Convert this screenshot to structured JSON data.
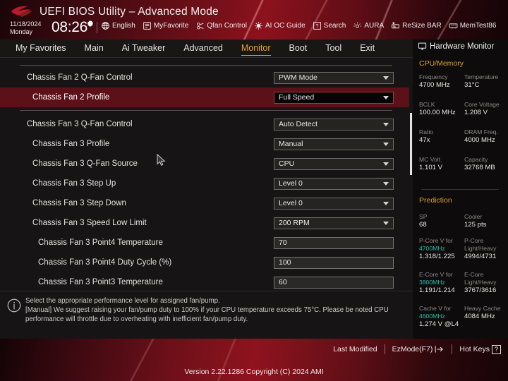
{
  "header": {
    "logo_icon": "rog-eye-logo",
    "title": "UEFI BIOS Utility – Advanced Mode",
    "date": "11/18/2024",
    "weekday": "Monday",
    "time": "08:26",
    "gear_icon": "gear-icon",
    "tools": [
      {
        "icon": "globe-icon",
        "label": "English"
      },
      {
        "icon": "star-list-icon",
        "label": "MyFavorite"
      },
      {
        "icon": "fan-icon",
        "label": "Qfan Control"
      },
      {
        "icon": "ai-chip-icon",
        "label": "AI OC Guide"
      },
      {
        "icon": "question-box-icon",
        "label": "Search"
      },
      {
        "icon": "aura-light-icon",
        "label": "AURA"
      },
      {
        "icon": "resize-bar-icon",
        "label": "ReSize BAR"
      },
      {
        "icon": "memtest-icon",
        "label": "MemTest86"
      }
    ]
  },
  "nav": {
    "tabs": [
      {
        "label": "My Favorites",
        "active": false
      },
      {
        "label": "Main",
        "active": false
      },
      {
        "label": "Ai Tweaker",
        "active": false
      },
      {
        "label": "Advanced",
        "active": false
      },
      {
        "label": "Monitor",
        "active": true
      },
      {
        "label": "Boot",
        "active": false
      },
      {
        "label": "Tool",
        "active": false
      },
      {
        "label": "Exit",
        "active": false
      }
    ],
    "active_color": "#e0a31e"
  },
  "settings": {
    "rows": [
      {
        "label": "Chassis Fan 2 Q-Fan Control",
        "value": "PWM Mode",
        "type": "dropdown",
        "indent": 1,
        "selected": false
      },
      {
        "label": "Chassis Fan 2 Profile",
        "value": "Full Speed",
        "type": "dropdown",
        "indent": 2,
        "selected": true
      },
      {
        "label": "Chassis Fan 3 Q-Fan Control",
        "value": "Auto Detect",
        "type": "dropdown",
        "indent": 1,
        "selected": false
      },
      {
        "label": "Chassis Fan 3 Profile",
        "value": "Manual",
        "type": "dropdown",
        "indent": 2,
        "selected": false
      },
      {
        "label": "Chassis Fan 3 Q-Fan Source",
        "value": "CPU",
        "type": "dropdown",
        "indent": 2,
        "selected": false
      },
      {
        "label": "Chassis Fan 3 Step Up",
        "value": "Level 0",
        "type": "dropdown",
        "indent": 2,
        "selected": false
      },
      {
        "label": "Chassis Fan 3 Step Down",
        "value": "Level 0",
        "type": "dropdown",
        "indent": 2,
        "selected": false
      },
      {
        "label": "Chassis Fan 3 Speed Low Limit",
        "value": "200 RPM",
        "type": "dropdown",
        "indent": 2,
        "selected": false
      },
      {
        "label": "Chassis Fan 3 Point4 Temperature",
        "value": "70",
        "type": "textbox",
        "indent": 3,
        "selected": false
      },
      {
        "label": "Chassis Fan 3 Point4 Duty Cycle (%)",
        "value": "100",
        "type": "textbox",
        "indent": 3,
        "selected": false
      },
      {
        "label": "Chassis Fan 3 Point3 Temperature",
        "value": "60",
        "type": "textbox",
        "indent": 3,
        "selected": false
      }
    ],
    "highlight_color": "#5c1118"
  },
  "help": {
    "icon": "info-circle-icon",
    "line1": "Select the appropriate performance level for assigned fan/pump.",
    "line2": "[Manual] We suggest raising your fan/pump duty to 100% if your CPU temperature exceeds 75°C. Please be noted CPU performance will throttle due to overheating with inefficient fan/pump duty."
  },
  "hardware_monitor": {
    "icon": "monitor-icon",
    "title": "Hardware Monitor",
    "sections": [
      {
        "name": "CPU/Memory",
        "pairs": [
          {
            "k1": "Frequency",
            "v1": "4700 MHz",
            "k2": "Temperature",
            "v2": "31°C"
          },
          {
            "k1": "BCLK",
            "v1": "100.00 MHz",
            "k2": "Core Voltage",
            "v2": "1.208 V"
          },
          {
            "k1": "Ratio",
            "v1": "47x",
            "k2": "DRAM Freq.",
            "v2": "4000 MHz"
          },
          {
            "k1": "MC Volt.",
            "v1": "1.101 V",
            "k2": "Capacity",
            "v2": "32768 MB"
          }
        ]
      },
      {
        "name": "Prediction",
        "pairs": [
          {
            "k1": "SP",
            "v1": "68",
            "k2": "Cooler",
            "v2": "125 pts"
          }
        ],
        "blocks": [
          {
            "l_key": "P-Core V for",
            "l_key2": "4700MHz",
            "l_val": "1.318/1.225",
            "r_key": "P-Core",
            "r_key2": "Light/Heavy",
            "r_val": "4994/4731"
          },
          {
            "l_key": "E-Core V for",
            "l_key2": "3800MHz",
            "l_val": "1.191/1.214",
            "r_key": "E-Core",
            "r_key2": "Light/Heavy",
            "r_val": "3767/3616"
          },
          {
            "l_key": "Cache V for",
            "l_key2": "4600MHz",
            "l_val": "1.274 V @L4",
            "r_key": "Heavy Cache",
            "r_key2": "",
            "r_val": "4084 MHz"
          }
        ]
      }
    ],
    "accent_color": "#d9a42a",
    "cyan_color": "#2fb8a8"
  },
  "footer": {
    "last_modified": "Last Modified",
    "ezmode": "EzMode(F7)",
    "ezmode_icon": "arrow-into-box-icon",
    "hotkeys": "Hot Keys",
    "hotkeys_key": "?",
    "version": "Version 2.22.1286 Copyright (C) 2024 AMI"
  }
}
